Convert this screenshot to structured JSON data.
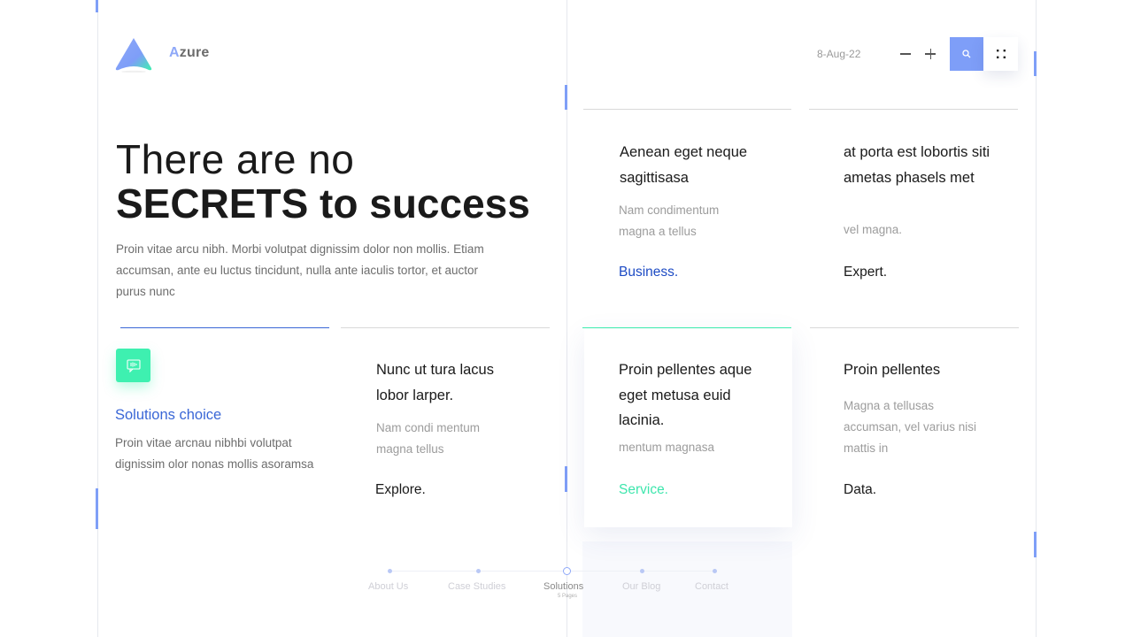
{
  "brand": {
    "first_letter": "A",
    "rest": "zure",
    "accent": "#8ea8f8"
  },
  "header": {
    "date": "8-Aug-22",
    "zoom_out_icon": "minus-icon",
    "zoom_in_icon": "plus-icon",
    "search_icon": "search-icon",
    "menu_icon": "dots-grid-icon"
  },
  "hero": {
    "line1": "There are no",
    "line2": "SECRETS to success",
    "body": "Proin vitae arcu nibh. Morbi volutpat dignissim dolor non mollis. Etiam accumsan, ante eu luctus tincidunt, nulla ante iaculis tortor, et auctor purus nunc"
  },
  "solutions": {
    "icon": "message-icon",
    "title": "Solutions choice",
    "body": "Proin vitae arcnau nibhbi volutpat dignissim olor nonas mollis asoramsa"
  },
  "cards": [
    {
      "title": "Aenean eget neque sagittisasa",
      "sub": "Nam condimentum magna a tellus",
      "link": "Business.",
      "link_color": "#1d4bc4"
    },
    {
      "title": "at porta est lobortis siti ametas phasels met",
      "sub": "vel magna.",
      "link": "Expert.",
      "link_color": "#1a1a1a"
    },
    {
      "title": "Nunc ut tura lacus lobor larper.",
      "sub": "Nam condi mentum magna tellus",
      "link": "Explore.",
      "link_color": "#1a1a1a"
    },
    {
      "title": "Proin pellentes aque eget metusa euid lacinia.",
      "sub": "mentum magnasa",
      "link": "Service.",
      "link_color": "#3ee6ad"
    },
    {
      "title": "Proin pellentes",
      "sub": "Magna a tellusas accumsan, vel varius nisi mattis in",
      "link": "Data.",
      "link_color": "#1a1a1a"
    }
  ],
  "nav": {
    "items": [
      "About Us",
      "Case Studies",
      "Solutions",
      "Our Blog",
      "Contact"
    ],
    "active": "Solutions",
    "active_sub": "5 Pages"
  },
  "colors": {
    "accent_blue": "#7e9ef8",
    "accent_green": "#3ef0b0",
    "link_blue": "#3a67d6"
  }
}
